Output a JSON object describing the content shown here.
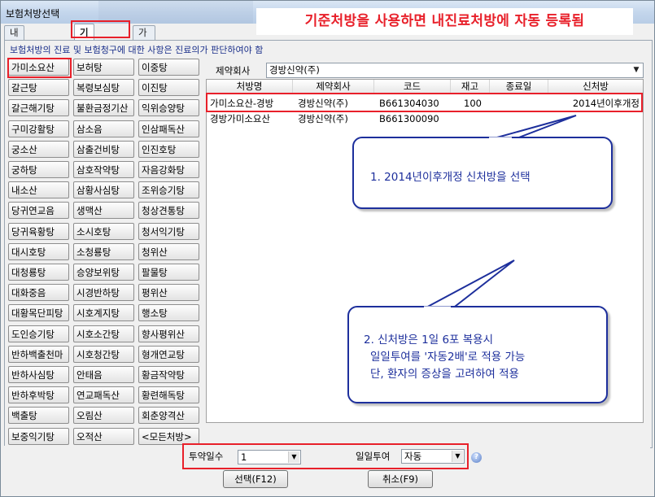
{
  "window": {
    "title": "보험처방선택"
  },
  "annotation": {
    "banner": "기준처방을 사용하면 내진료처방에 자동 등록됨"
  },
  "tabs": [
    {
      "label": "내진료처방"
    },
    {
      "label": "기준처방"
    },
    {
      "label": "가감/임의처방"
    }
  ],
  "notice": "보험처방의 진료 및 보험청구에 대한 사항은 진료의가 판단하여야 함",
  "herbs": {
    "col1": [
      "가미소요산",
      "갈근탕",
      "갈근해기탕",
      "구미강활탕",
      "궁소산",
      "궁하탕",
      "내소산",
      "당귀연교음",
      "당귀육황탕",
      "대시호탕",
      "대청룡탕",
      "대화중음",
      "대황목단피탕",
      "도인승기탕",
      "반하백출천마",
      "반하사심탕",
      "반하후박탕",
      "백출탕",
      "보중익기탕"
    ],
    "col2": [
      "보허탕",
      "복령보심탕",
      "불환금정기산",
      "삼소음",
      "삼출건비탕",
      "삼호작약탕",
      "삼황사심탕",
      "생맥산",
      "소시호탕",
      "소청룡탕",
      "승양보위탕",
      "시경반하탕",
      "시호계지탕",
      "시호소간탕",
      "시호청간탕",
      "안태음",
      "연교패독산",
      "오림산",
      "오적산"
    ],
    "col3": [
      "이중탕",
      "이진탕",
      "익위승양탕",
      "인삼패독산",
      "인진호탕",
      "자음강화탕",
      "조위승기탕",
      "청상견통탕",
      "청서익기탕",
      "청위산",
      "팔물탕",
      "평위산",
      "행소탕",
      "향사평위산",
      "형개연교탕",
      "황금작약탕",
      "황련해독탕",
      "회춘양격산",
      "<모든처방>"
    ]
  },
  "company": {
    "label": "제약회사",
    "value": "경방신약(주)"
  },
  "table": {
    "headers": [
      "처방명",
      "제약회사",
      "코드",
      "재고",
      "종료일",
      "신처방"
    ],
    "rows": [
      [
        "가미소요산-경방",
        "경방신약(주)",
        "B661304030",
        "100",
        "",
        "2014년이후개정"
      ],
      [
        "경방가미소요산",
        "경방신약(주)",
        "B661300090",
        "",
        "",
        ""
      ]
    ]
  },
  "callouts": {
    "c1": "1. 2014년이후개정 신처방을 선택",
    "c2_line1": "2. 신처방은 1일 6포 복용시",
    "c2_line2": "일일투여를 '자동2배'로 적용 가능",
    "c2_line3": "단, 환자의 증상을 고려하여 적용"
  },
  "bottom": {
    "days_label": "투약일수",
    "days_value": "1",
    "daily_label": "일일투여",
    "daily_value": "자동",
    "select_button": "선택(F12)",
    "cancel_button": "취소(F9)"
  },
  "colors": {
    "annotation_red": "#e8202a",
    "callout_blue": "#1d2f9c"
  }
}
